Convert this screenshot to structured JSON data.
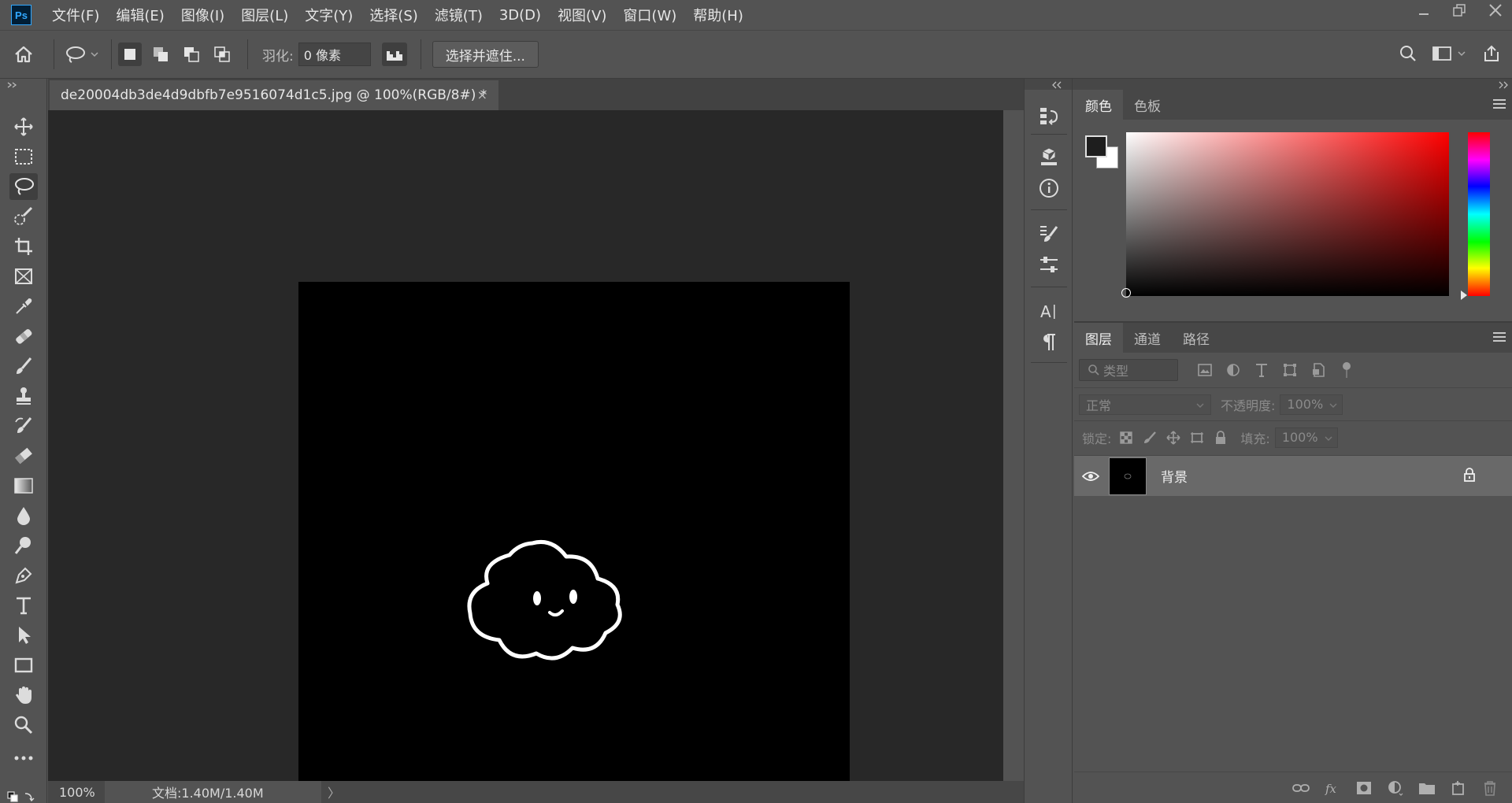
{
  "app": {
    "logo": "Ps",
    "menu": [
      "文件(F)",
      "编辑(E)",
      "图像(I)",
      "图层(L)",
      "文字(Y)",
      "选择(S)",
      "滤镜(T)",
      "3D(D)",
      "视图(V)",
      "窗口(W)",
      "帮助(H)"
    ]
  },
  "options": {
    "feather_label": "羽化:",
    "feather_value": "0 像素",
    "select_mask_button": "选择并遮住..."
  },
  "document": {
    "tab_title": "de20004db3de4d9dbfb7e9516074d1c5.jpg @ 100%(RGB/8#) *",
    "close_glyph": "×",
    "zoom": "100%",
    "doc_info": "文档:1.40M/1.40M",
    "status_arrow": "〉"
  },
  "color_panel": {
    "tabs": [
      "颜色",
      "色板"
    ],
    "foreground": "#1e1e1e",
    "background": "#ffffff"
  },
  "layers_panel": {
    "tabs": [
      "图层",
      "通道",
      "路径"
    ],
    "filter_placeholder": "类型",
    "blend_mode": "正常",
    "opacity_label": "不透明度:",
    "opacity_value": "100%",
    "lock_label": "锁定:",
    "fill_label": "填充:",
    "fill_value": "100%",
    "layers": [
      {
        "name": "背景",
        "visible": true,
        "locked": true
      }
    ]
  },
  "colors": {
    "ui_bg": "#535353",
    "canvas_bg": "#282828",
    "accent": "#31a8ff"
  }
}
